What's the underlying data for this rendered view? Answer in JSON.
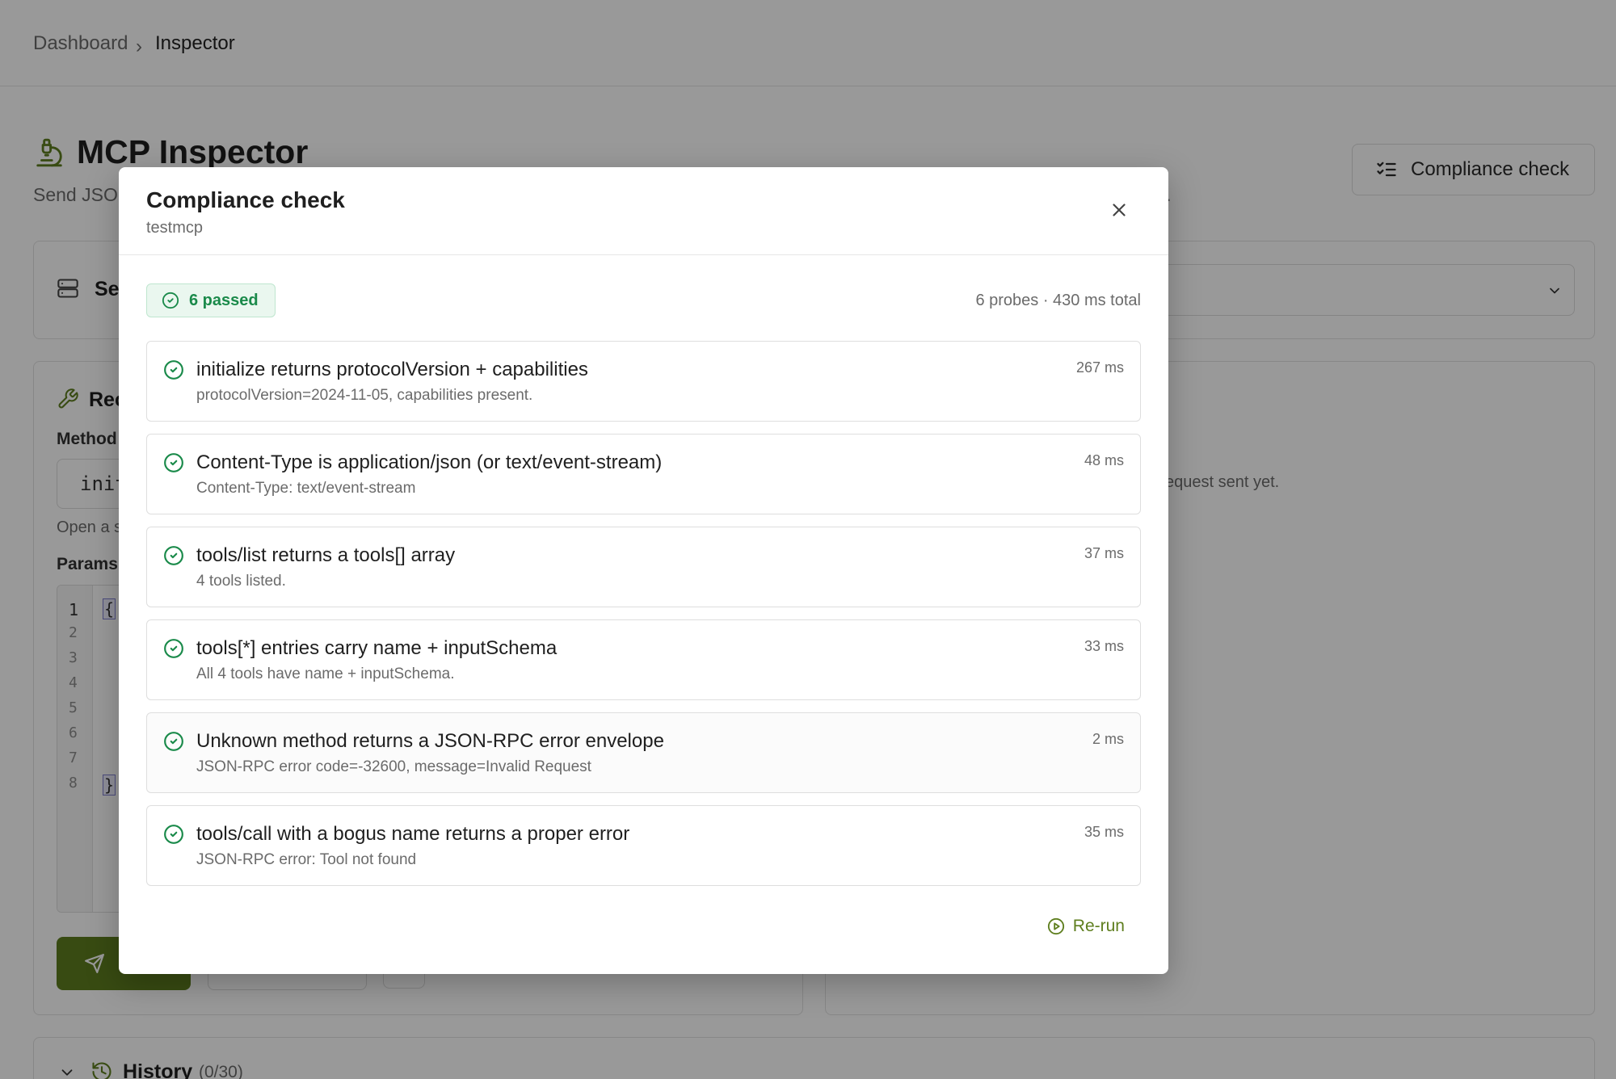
{
  "breadcrumb": {
    "root": "Dashboard",
    "separator": "›",
    "current": "Inspector"
  },
  "page": {
    "title": "MCP Inspector",
    "subtitle_start": "Send JSO",
    "subtitle_end": "l.",
    "compliance_button": "Compliance check"
  },
  "server_panel": {
    "label": "Se"
  },
  "request_panel": {
    "title": "Rec",
    "method_label": "Method",
    "method_value": "init",
    "method_hint": "Open a s",
    "params_label": "Params",
    "line_numbers": [
      "1",
      "2",
      "3",
      "4",
      "5",
      "6",
      "7",
      "8"
    ],
    "open_brace": "{",
    "close_brace": "}"
  },
  "response_panel": {
    "empty_text": "equest sent yet."
  },
  "history": {
    "title": "History",
    "count": "(0/30)"
  },
  "modal": {
    "title": "Compliance check",
    "subtitle": "testmcp",
    "badge": "6 passed",
    "summary": "6 probes · 430 ms total",
    "rerun_label": "Re-run",
    "probes": [
      {
        "title": "initialize returns protocolVersion + capabilities",
        "detail": "protocolVersion=2024-11-05, capabilities present.",
        "time": "267 ms",
        "status": "pass"
      },
      {
        "title": "Content-Type is application/json (or text/event-stream)",
        "detail": "Content-Type: text/event-stream",
        "time": "48 ms",
        "status": "pass"
      },
      {
        "title": "tools/list returns a tools[] array",
        "detail": "4 tools listed.",
        "time": "37 ms",
        "status": "pass"
      },
      {
        "title": "tools[*] entries carry name + inputSchema",
        "detail": "All 4 tools have name + inputSchema.",
        "time": "33 ms",
        "status": "pass"
      },
      {
        "title": "Unknown method returns a JSON-RPC error envelope",
        "detail": "JSON-RPC error code=-32600, message=Invalid Request",
        "time": "2 ms",
        "status": "pass"
      },
      {
        "title": "tools/call with a bogus name returns a proper error",
        "detail": "JSON-RPC error: Tool not found",
        "time": "35 ms",
        "status": "pass"
      }
    ]
  },
  "colors": {
    "accent": "#5e7e1e",
    "pass": "#1a8a4a",
    "pass_bg": "#eaf7ef",
    "icon_pass": "check-circle-icon"
  }
}
